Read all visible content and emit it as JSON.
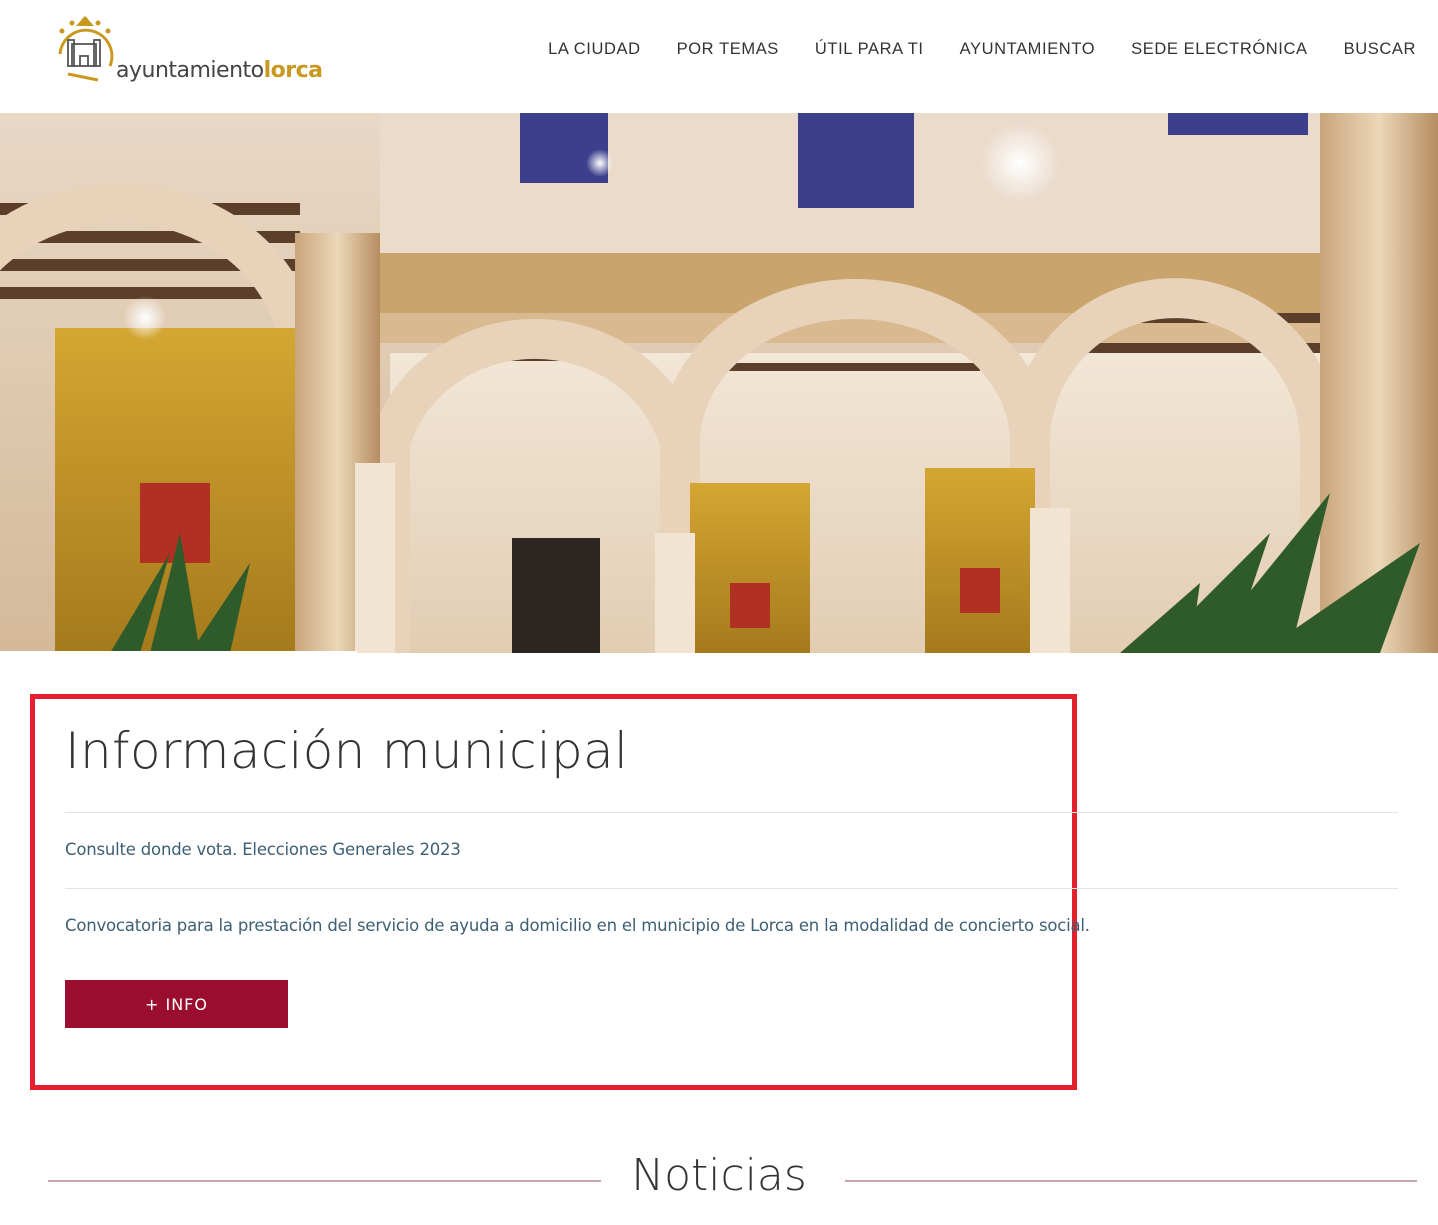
{
  "logo": {
    "text_regular": "ayuntamiento",
    "text_bold": "lorca"
  },
  "nav": {
    "items": [
      {
        "label": "LA CIUDAD"
      },
      {
        "label": "POR TEMAS"
      },
      {
        "label": "ÚTIL PARA TI"
      },
      {
        "label": "AYUNTAMIENTO"
      },
      {
        "label": "SEDE ELECTRÓNICA"
      },
      {
        "label": "BUSCAR"
      }
    ]
  },
  "info": {
    "title": "Información municipal",
    "links": [
      {
        "label": "Consulte donde vota. Elecciones Generales 2023"
      },
      {
        "label": "Convocatoria para la prestación del servicio de ayuda a domicilio en el municipio de Lorca en la modalidad de concierto social."
      }
    ],
    "button_label": "+ INFO"
  },
  "news": {
    "title": "Noticias"
  },
  "colors": {
    "accent": "#9b0d2e",
    "highlight_frame": "#e5202e",
    "link": "#3d5f74",
    "logo_gold": "#c9981e"
  }
}
